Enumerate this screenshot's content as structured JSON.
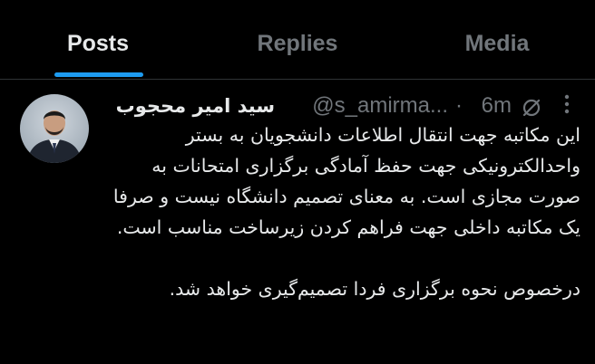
{
  "tabs": [
    {
      "label": "Posts",
      "active": true
    },
    {
      "label": "Replies",
      "active": false
    },
    {
      "label": "Media",
      "active": false
    }
  ],
  "colors": {
    "accent": "#1d9bf0",
    "background": "#000000",
    "text": "#e7e9ea",
    "muted": "#71767b"
  },
  "tweet": {
    "display_name": "سید امیر محجوب",
    "handle": "@s_amirma...",
    "separator": "·",
    "time": "6m",
    "avatar_icon": "user-avatar",
    "grok_icon": "grok-icon",
    "more_icon": "more-icon",
    "paragraphs": [
      "این مکاتبه جهت انتقال اطلاعات دانشجویان به بستر واحدالکترونیکی جهت حفظ آمادگی برگزاری امتحانات به صورت مجازی است. به معنای تصمیم دانشگاه نیست و صرفا یک مکاتبه داخلی جهت فراهم کردن زیرساخت مناسب است.",
      "درخصوص نحوه برگزاری فردا تصمیم‌گیری خواهد شد."
    ]
  }
}
